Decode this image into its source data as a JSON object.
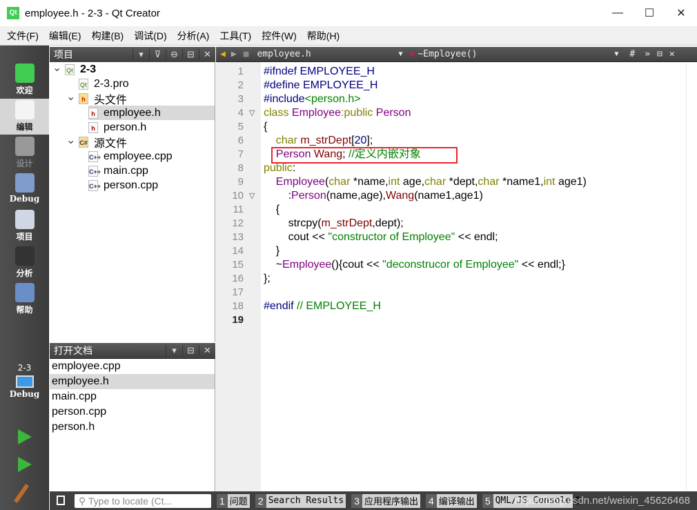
{
  "window": {
    "title": "employee.h - 2-3 - Qt Creator",
    "minimize": "—",
    "maximize": "☐",
    "close": "✕"
  },
  "menu": [
    "文件(F)",
    "编辑(E)",
    "构建(B)",
    "调试(D)",
    "分析(A)",
    "工具(T)",
    "控件(W)",
    "帮助(H)"
  ],
  "modes": [
    {
      "label": "欢迎",
      "icon": "qt-logo-icon"
    },
    {
      "label": "编辑",
      "icon": "edit-icon",
      "active": true
    },
    {
      "label": "设计",
      "icon": "design-icon",
      "disabled": true
    },
    {
      "label": "Debug",
      "icon": "bug-icon"
    },
    {
      "label": "项目",
      "icon": "project-icon"
    },
    {
      "label": "分析",
      "icon": "analyze-icon"
    },
    {
      "label": "帮助",
      "icon": "help-icon"
    }
  ],
  "kit": {
    "project": "2-3",
    "config": "Debug"
  },
  "projects_panel": {
    "title": "项目",
    "tree": [
      {
        "label": "2-3",
        "level": 0,
        "expanded": true,
        "icon": "qt-project-icon",
        "bold": true
      },
      {
        "label": "2-3.pro",
        "level": 1,
        "icon": "pro-file-icon"
      },
      {
        "label": "头文件",
        "level": 1,
        "expanded": true,
        "icon": "headers-folder-icon"
      },
      {
        "label": "employee.h",
        "level": 2,
        "icon": "header-file-icon",
        "selected": true
      },
      {
        "label": "person.h",
        "level": 2,
        "icon": "header-file-icon"
      },
      {
        "label": "源文件",
        "level": 1,
        "expanded": true,
        "icon": "sources-folder-icon"
      },
      {
        "label": "employee.cpp",
        "level": 2,
        "icon": "cpp-file-icon"
      },
      {
        "label": "main.cpp",
        "level": 2,
        "icon": "cpp-file-icon"
      },
      {
        "label": "person.cpp",
        "level": 2,
        "icon": "cpp-file-icon"
      }
    ]
  },
  "open_docs": {
    "title": "打开文档",
    "items": [
      "employee.cpp",
      "employee.h",
      "main.cpp",
      "person.cpp",
      "person.h"
    ],
    "selected": "employee.h"
  },
  "editor": {
    "file": "employee.h",
    "symbol": "~Employee()",
    "hash": "#",
    "current_line": 19,
    "fold_lines": [
      4,
      10
    ],
    "lines": [
      [
        [
          "#ifndef EMPLOYEE_H",
          "p"
        ]
      ],
      [
        [
          "#define EMPLOYEE_H",
          "p"
        ]
      ],
      [
        [
          "#include",
          "p"
        ],
        [
          "<person.h>",
          "s"
        ]
      ],
      [
        [
          "class ",
          "k"
        ],
        [
          "Employee",
          "ty"
        ],
        [
          ":",
          "k"
        ],
        [
          "public ",
          "k"
        ],
        [
          "Person",
          "ty"
        ]
      ],
      [
        [
          "{",
          ""
        ]
      ],
      [
        [
          "    ",
          ""
        ],
        [
          "char ",
          "k"
        ],
        [
          "m_strDept",
          "m"
        ],
        [
          "[",
          ""
        ],
        [
          "20",
          "n"
        ],
        [
          "];",
          ""
        ]
      ],
      [
        [
          "    ",
          ""
        ],
        [
          "Person ",
          "ty"
        ],
        [
          "Wang",
          "m"
        ],
        [
          "; ",
          ""
        ],
        [
          "//定义内嵌对象",
          "c"
        ]
      ],
      [
        [
          "public",
          "k"
        ],
        [
          ":",
          ""
        ]
      ],
      [
        [
          "    ",
          ""
        ],
        [
          "Employee",
          "ty"
        ],
        [
          "(",
          ""
        ],
        [
          "char ",
          "k"
        ],
        [
          "*name,",
          ""
        ],
        [
          "int ",
          "k"
        ],
        [
          "age,",
          ""
        ],
        [
          "char ",
          "k"
        ],
        [
          "*dept,",
          ""
        ],
        [
          "char ",
          "k"
        ],
        [
          "*name1,",
          ""
        ],
        [
          "int ",
          "k"
        ],
        [
          "age1)",
          ""
        ]
      ],
      [
        [
          "        :",
          ""
        ],
        [
          "Person",
          "ty"
        ],
        [
          "(name,age),",
          ""
        ],
        [
          "Wang",
          "m"
        ],
        [
          "(name1,age1)",
          ""
        ]
      ],
      [
        [
          "    {",
          ""
        ]
      ],
      [
        [
          "        strcpy(",
          ""
        ],
        [
          "m_strDept",
          "m"
        ],
        [
          ",dept);",
          ""
        ]
      ],
      [
        [
          "        cout << ",
          ""
        ],
        [
          "\"constructor of Employee\"",
          "s"
        ],
        [
          " << endl;",
          ""
        ]
      ],
      [
        [
          "    }",
          ""
        ]
      ],
      [
        [
          "    ~",
          ""
        ],
        [
          "Employee",
          "ty"
        ],
        [
          "(){cout << ",
          ""
        ],
        [
          "\"deconstrucor of Employee\"",
          "s"
        ],
        [
          " << endl;}",
          ""
        ]
      ],
      [
        [
          "};",
          ""
        ]
      ],
      [
        [
          "",
          ""
        ]
      ],
      [
        [
          "#endif ",
          "p"
        ],
        [
          "// EMPLOYEE_H",
          "c"
        ]
      ],
      [
        [
          "",
          ""
        ]
      ]
    ]
  },
  "bottom": {
    "locator_placeholder": "Type to locate (Ct...",
    "panes": [
      {
        "num": "1",
        "label": "问题"
      },
      {
        "num": "2",
        "label": "Search Results"
      },
      {
        "num": "3",
        "label": "应用程序输出"
      },
      {
        "num": "4",
        "label": "编译输出"
      },
      {
        "num": "5",
        "label": "QML/JS Console"
      }
    ]
  },
  "watermark": "https://blog.csdn.net/weixin_45626468",
  "colors": {
    "keyword": "#808000",
    "type": "#800080",
    "string": "#008000",
    "member": "#800000",
    "number": "#000080",
    "highlight_box": "#e8242a"
  }
}
